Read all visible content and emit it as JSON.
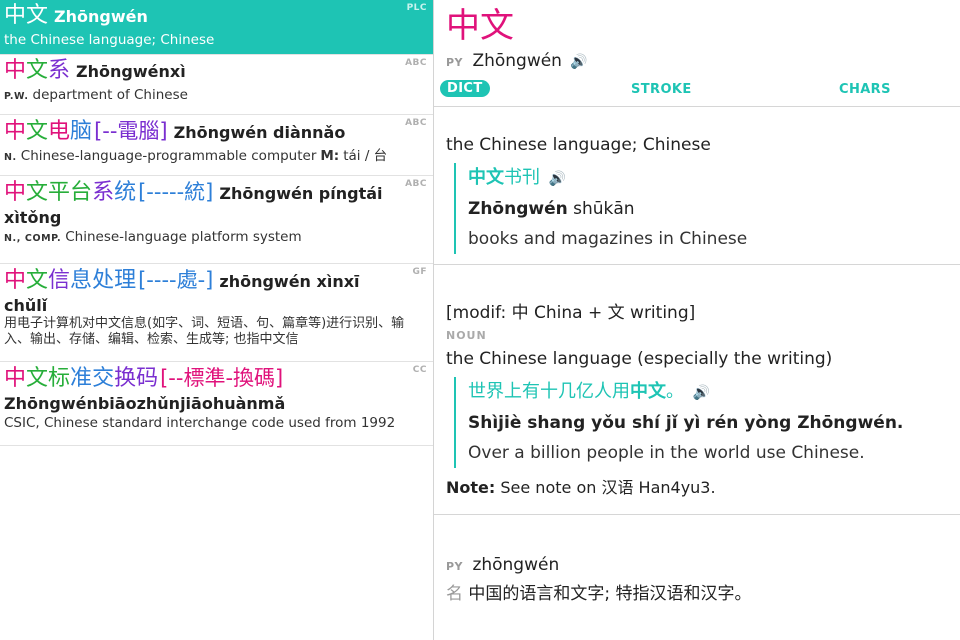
{
  "entries": [
    {
      "source": "PLC",
      "hanzi": [
        {
          "c": "中",
          "color": "#ffffff"
        },
        {
          "c": "文",
          "color": "#ffffff"
        }
      ],
      "trad": "",
      "pinyin": "Zhōngwén",
      "pinyin_wrap": "",
      "pos": "",
      "definition": "the Chinese language; Chinese",
      "measure_label": "",
      "measure": ""
    },
    {
      "source": "ABC",
      "hanzi": [
        {
          "c": "中",
          "color": "#e0127b"
        },
        {
          "c": "文",
          "color": "#27ae3a"
        },
        {
          "c": "系",
          "color": "#7a2fd0"
        }
      ],
      "trad": "",
      "pinyin": "Zhōngwénxì",
      "pinyin_wrap": "",
      "pos": "P.W.",
      "definition": "department of Chinese",
      "measure_label": "",
      "measure": ""
    },
    {
      "source": "ABC",
      "hanzi": [
        {
          "c": "中",
          "color": "#e0127b"
        },
        {
          "c": "文",
          "color": "#27ae3a"
        },
        {
          "c": "电",
          "color": "#e0127b"
        },
        {
          "c": "脑",
          "color": "#2d7fd8"
        }
      ],
      "trad": "[--電腦]",
      "trad_color": "#7a2fd0",
      "pinyin": "Zhōngwén diànnǎo",
      "pinyin_wrap": "",
      "pos": "N.",
      "definition": "Chinese-language-programmable computer",
      "measure_label": "M:",
      "measure": "tái / 台"
    },
    {
      "source": "ABC",
      "hanzi": [
        {
          "c": "中",
          "color": "#e0127b"
        },
        {
          "c": "文",
          "color": "#27ae3a"
        },
        {
          "c": "平",
          "color": "#27ae3a"
        },
        {
          "c": "台",
          "color": "#27ae3a"
        },
        {
          "c": "系",
          "color": "#7a2fd0"
        },
        {
          "c": "统",
          "color": "#2d7fd8"
        }
      ],
      "trad": "[-----統]",
      "trad_color": "#2d7fd8",
      "pinyin": "Zhōngwén píngtái",
      "pinyin_wrap": "xìtǒng",
      "pos": "N., COMP.",
      "definition": "Chinese-language platform system",
      "measure_label": "",
      "measure": ""
    },
    {
      "source": "GF",
      "hanzi": [
        {
          "c": "中",
          "color": "#e0127b"
        },
        {
          "c": "文",
          "color": "#27ae3a"
        },
        {
          "c": "信",
          "color": "#7a2fd0"
        },
        {
          "c": "息",
          "color": "#2d7fd8"
        },
        {
          "c": "处",
          "color": "#2d7fd8"
        },
        {
          "c": "理",
          "color": "#2d7fd8"
        }
      ],
      "trad": "[----處-]",
      "trad_color": "#2d7fd8",
      "pinyin": "zhōngwén xìnxī",
      "pinyin_wrap": "chǔlǐ",
      "pos": "",
      "definition": "用电子计算机对中文信息(如字、词、短语、句、篇章等)进行识别、输入、输出、存储、编辑、检索、生成等; 也指中文信",
      "measure_label": "",
      "measure": ""
    },
    {
      "source": "CC",
      "hanzi": [
        {
          "c": "中",
          "color": "#e0127b"
        },
        {
          "c": "文",
          "color": "#27ae3a"
        },
        {
          "c": "标",
          "color": "#27ae3a"
        },
        {
          "c": "准",
          "color": "#2d7fd8"
        },
        {
          "c": "交",
          "color": "#2d7fd8"
        },
        {
          "c": "换",
          "color": "#7a2fd0"
        },
        {
          "c": "码",
          "color": "#7a2fd0"
        }
      ],
      "trad": "[--標準-換碼]",
      "trad_color": "#e0127b",
      "pinyin": "",
      "pinyin_wrap": "Zhōngwénbiāozhǔnjiāohuànmǎ",
      "pos": "",
      "definition": "CSIC, Chinese standard interchange code used from 1992",
      "measure_label": "",
      "measure": ""
    }
  ],
  "detail": {
    "hanzi": "中文",
    "hanzi_color": "#e0127b",
    "py_tag": "PY",
    "pinyin": "Zhōngwén",
    "tabs": [
      {
        "label": "DICT",
        "active": true
      },
      {
        "label": "STROKE",
        "active": false
      },
      {
        "label": "CHARS",
        "active": false
      }
    ],
    "section1": {
      "sense": "the Chinese language; Chinese",
      "example_cn_pre": "",
      "example_cn_bold": "中文",
      "example_cn_post": "书刊",
      "example_py_bold": "Zhōngwén",
      "example_py_rest": " shūkān",
      "example_en": "books and magazines in Chinese"
    },
    "section2": {
      "etym": "[modif: 中 China + 文 writing]",
      "pos": "NOUN",
      "sense": "the Chinese language (especially the writing)",
      "example_cn_pre": "世界上有十几亿人用",
      "example_cn_bold": "中文",
      "example_cn_post": "。",
      "example_py_pre": "Shìjiè shang yǒu shí jǐ yì rén yòng",
      "example_py_bold": "Zhōngwén",
      "example_py_post": ".",
      "example_en": "Over a billion people in the world use Chinese.",
      "note_label": "Note:",
      "note_text": "See note on 汉语 Han4yu3."
    },
    "section3": {
      "py_tag": "PY",
      "pinyin": "zhōngwén",
      "label": "名",
      "definition": "中国的语言和文字; 特指汉语和汉字。"
    }
  }
}
